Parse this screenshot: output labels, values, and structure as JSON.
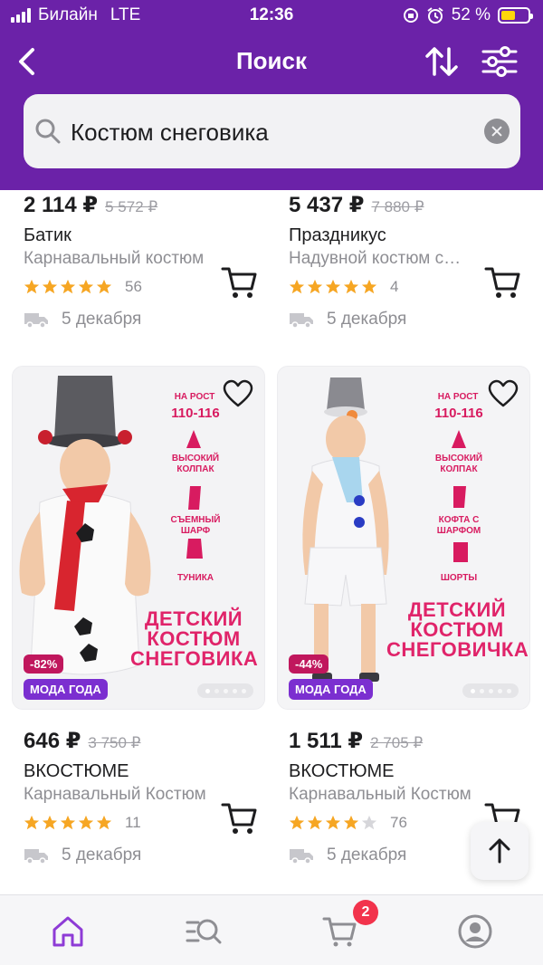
{
  "status_bar": {
    "carrier": "Билайн",
    "network": "LTE",
    "time": "12:36",
    "battery": "52 %",
    "battery_level": 0.52
  },
  "nav": {
    "title": "Поиск"
  },
  "search": {
    "query": "Костюм снеговика"
  },
  "products_top": [
    {
      "price": "2 114 ₽",
      "old_price": "5 572 ₽",
      "brand": "Батик",
      "title": "Карнавальный костюм",
      "rating": 5,
      "reviews": "56",
      "delivery": "5 декабря"
    },
    {
      "price": "5 437 ₽",
      "old_price": "7 880 ₽",
      "brand": "Праздникус",
      "title": "Надувной костюм снеговика",
      "rating": 5,
      "reviews": "4",
      "delivery": "5 декабря"
    }
  ],
  "products_bottom": [
    {
      "promo": {
        "height_label": "НА РОСТ",
        "height_value": "110-116",
        "f1": "ВЫСОКИЙ КОЛПАК",
        "f2": "СЪЕМНЫЙ ШАРФ",
        "f3": "ТУНИКА",
        "big": "ДЕТСКИЙ КОСТЮМ СНЕГОВИКА"
      },
      "discount": "-82%",
      "label": "МОДА ГОДА",
      "price": "646 ₽",
      "old_price": "3 750 ₽",
      "brand": "ВКОСТЮМЕ",
      "title": "Карнавальный Костюм",
      "rating": 5,
      "reviews": "11",
      "delivery": "5 декабря"
    },
    {
      "promo": {
        "height_label": "НА РОСТ",
        "height_value": "110-116",
        "f1": "ВЫСОКИЙ КОЛПАК",
        "f2": "КОФТА С ШАРФОМ",
        "f3": "ШОРТЫ",
        "big": "ДЕТСКИЙ КОСТЮМ СНЕГОВИЧКА"
      },
      "discount": "-44%",
      "label": "МОДА ГОДА",
      "price": "1 511 ₽",
      "old_price": "2 705 ₽",
      "brand": "ВКОСТЮМЕ",
      "title": "Карнавальный Костюм",
      "rating": 4,
      "reviews": "76",
      "delivery": "5 декабря"
    }
  ],
  "tabbar": {
    "cart_count": "2",
    "active": "home"
  },
  "colors": {
    "brand": "#6b22a8",
    "star": "#f6a623",
    "discount": "#c0175d",
    "badge": "#f2334c"
  }
}
